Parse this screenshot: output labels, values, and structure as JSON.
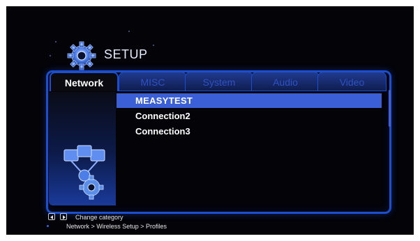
{
  "header": {
    "title": "SETUP",
    "icon": "gear-icon"
  },
  "tabs": [
    {
      "label": "Network",
      "active": true
    },
    {
      "label": "MISC",
      "active": false
    },
    {
      "label": "System",
      "active": false
    },
    {
      "label": "Audio",
      "active": false
    },
    {
      "label": "Video",
      "active": false
    }
  ],
  "profiles": [
    {
      "label": "MEASYTEST",
      "selected": true
    },
    {
      "label": "Connection2",
      "selected": false
    },
    {
      "label": "Connection3",
      "selected": false
    }
  ],
  "footer": {
    "hint": "Change category",
    "breadcrumb": "Network > Wireless Setup > Profiles",
    "icons": [
      "left-arrow-key-icon",
      "right-arrow-key-icon"
    ]
  },
  "colors": {
    "accent": "#3b5fd6",
    "frame": "#1c4fd0",
    "background": "#030308"
  }
}
